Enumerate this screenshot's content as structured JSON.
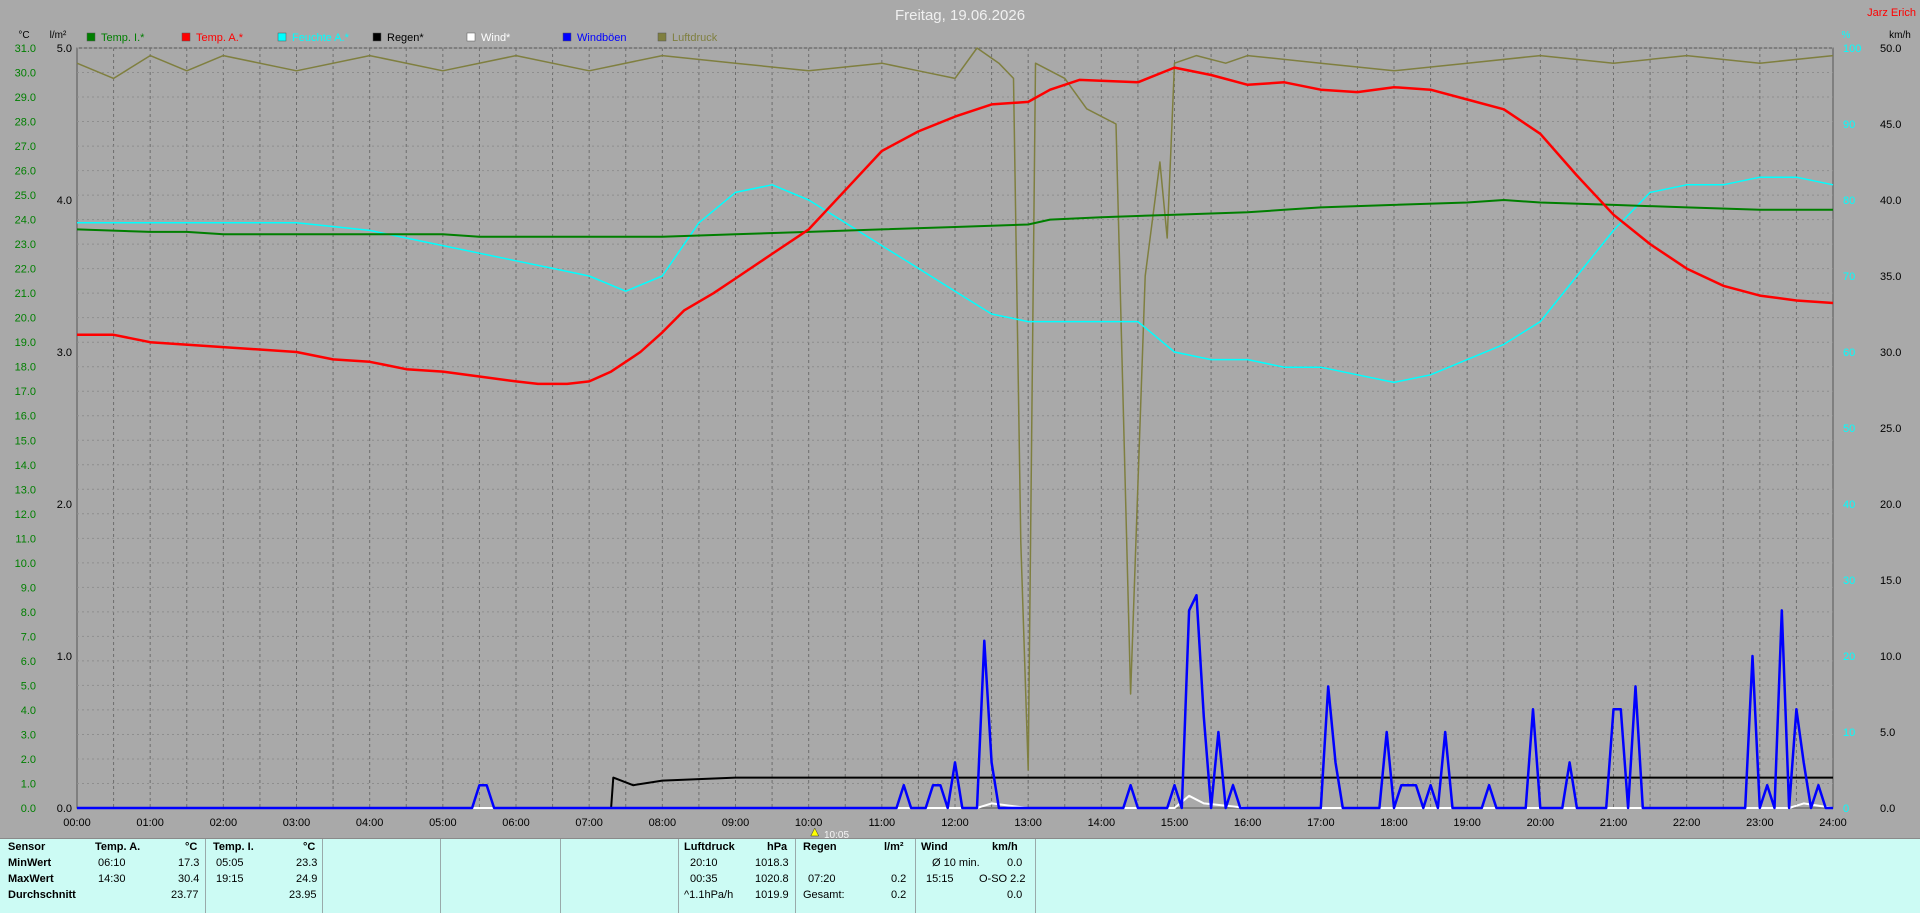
{
  "chart_data": {
    "type": "line",
    "title": "Freitag, 19.06.2026",
    "station": "Jarz Erich",
    "left_axis_unit": "°C",
    "left_axis2_unit": "l/m²",
    "right_axis_unit": "%",
    "right_axis2_unit": "km/h",
    "temp_ticks": [
      "0.0",
      "1.0",
      "2.0",
      "3.0",
      "4.0",
      "5.0",
      "6.0",
      "7.0",
      "8.0",
      "9.0",
      "10.0",
      "11.0",
      "12.0",
      "13.0",
      "14.0",
      "15.0",
      "16.0",
      "17.0",
      "18.0",
      "19.0",
      "20.0",
      "21.0",
      "22.0",
      "23.0",
      "24.0",
      "25.0",
      "26.0",
      "27.0",
      "28.0",
      "29.0",
      "30.0",
      "31.0"
    ],
    "rain_ticks": [
      "0.0",
      "1.0",
      "2.0",
      "3.0",
      "4.0",
      "5.0"
    ],
    "wind_ticks": [
      "0.0",
      "5.0",
      "10.0",
      "15.0",
      "20.0",
      "25.0",
      "30.0",
      "35.0",
      "40.0",
      "45.0",
      "50.0"
    ],
    "humidity_ticks": [
      "0",
      "10",
      "20",
      "30",
      "40",
      "50",
      "60",
      "70",
      "80",
      "90",
      "100"
    ],
    "x_labels": [
      "00:00",
      "01:00",
      "02:00",
      "03:00",
      "04:00",
      "05:00",
      "06:00",
      "07:00",
      "08:00",
      "09:00",
      "10:00",
      "11:00",
      "12:00",
      "13:00",
      "14:00",
      "15:00",
      "16:00",
      "17:00",
      "18:00",
      "19:00",
      "20:00",
      "21:00",
      "22:00",
      "23:00",
      "24:00"
    ],
    "xlim": [
      0,
      24
    ],
    "temp_ylim": [
      0,
      31
    ],
    "rain_ylim": [
      0,
      5
    ],
    "wind_ylim": [
      0,
      50
    ],
    "humidity_ylim": [
      0,
      100
    ],
    "marker_label": "10:05",
    "legend": [
      {
        "label": "Temp. I.*",
        "color": "#007f00"
      },
      {
        "label": "Temp. A.*",
        "color": "#ff0000"
      },
      {
        "label": "Feuchte A.*",
        "color": "#00ffff"
      },
      {
        "label": "Regen*",
        "color": "#000000"
      },
      {
        "label": "Wind*",
        "color": "#ffffff"
      },
      {
        "label": "Windböen",
        "color": "#0000ff"
      },
      {
        "label": "Luftdruck",
        "color": "#7f7f3f"
      }
    ],
    "series": [
      {
        "name": "Temp. I.*",
        "axis": "temp",
        "color": "#007f00",
        "points": [
          [
            0,
            23.6
          ],
          [
            1,
            23.5
          ],
          [
            1.5,
            23.5
          ],
          [
            2,
            23.4
          ],
          [
            3,
            23.4
          ],
          [
            4,
            23.4
          ],
          [
            5,
            23.4
          ],
          [
            5.5,
            23.3
          ],
          [
            6,
            23.3
          ],
          [
            7,
            23.3
          ],
          [
            8,
            23.3
          ],
          [
            9,
            23.4
          ],
          [
            10,
            23.5
          ],
          [
            11,
            23.6
          ],
          [
            12,
            23.7
          ],
          [
            13,
            23.8
          ],
          [
            13.3,
            24.0
          ],
          [
            14,
            24.1
          ],
          [
            15,
            24.2
          ],
          [
            16,
            24.3
          ],
          [
            16.5,
            24.4
          ],
          [
            17,
            24.5
          ],
          [
            18,
            24.6
          ],
          [
            19,
            24.7
          ],
          [
            19.5,
            24.8
          ],
          [
            20,
            24.7
          ],
          [
            21,
            24.6
          ],
          [
            22,
            24.5
          ],
          [
            23,
            24.4
          ],
          [
            24,
            24.4
          ]
        ]
      },
      {
        "name": "Temp. A.*",
        "axis": "temp",
        "color": "#ff0000",
        "points": [
          [
            0,
            19.3
          ],
          [
            0.5,
            19.3
          ],
          [
            1,
            19.0
          ],
          [
            2,
            18.8
          ],
          [
            3,
            18.6
          ],
          [
            3.5,
            18.3
          ],
          [
            4,
            18.2
          ],
          [
            4.5,
            17.9
          ],
          [
            5,
            17.8
          ],
          [
            5.5,
            17.6
          ],
          [
            6,
            17.4
          ],
          [
            6.3,
            17.3
          ],
          [
            6.7,
            17.3
          ],
          [
            7,
            17.4
          ],
          [
            7.3,
            17.8
          ],
          [
            7.7,
            18.6
          ],
          [
            8,
            19.4
          ],
          [
            8.3,
            20.3
          ],
          [
            8.7,
            21.0
          ],
          [
            9,
            21.6
          ],
          [
            9.5,
            22.6
          ],
          [
            10,
            23.6
          ],
          [
            10.5,
            25.2
          ],
          [
            11,
            26.8
          ],
          [
            11.5,
            27.6
          ],
          [
            12,
            28.2
          ],
          [
            12.5,
            28.7
          ],
          [
            13,
            28.8
          ],
          [
            13.3,
            29.3
          ],
          [
            13.7,
            29.7
          ],
          [
            14.5,
            29.6
          ],
          [
            15,
            30.2
          ],
          [
            15.5,
            29.9
          ],
          [
            16,
            29.5
          ],
          [
            16.5,
            29.6
          ],
          [
            17,
            29.3
          ],
          [
            17.5,
            29.2
          ],
          [
            18,
            29.4
          ],
          [
            18.5,
            29.3
          ],
          [
            19,
            28.9
          ],
          [
            19.5,
            28.5
          ],
          [
            20,
            27.5
          ],
          [
            20.5,
            25.8
          ],
          [
            21,
            24.2
          ],
          [
            21.5,
            23.0
          ],
          [
            22,
            22.0
          ],
          [
            22.5,
            21.3
          ],
          [
            23,
            20.9
          ],
          [
            23.5,
            20.7
          ],
          [
            24,
            20.6
          ]
        ]
      },
      {
        "name": "Feuchte A.*",
        "axis": "humidity",
        "color": "#00ffff",
        "points": [
          [
            0,
            77
          ],
          [
            1,
            77
          ],
          [
            2,
            77
          ],
          [
            3,
            77
          ],
          [
            4,
            76
          ],
          [
            5,
            74
          ],
          [
            5.5,
            73
          ],
          [
            6,
            72
          ],
          [
            6.5,
            71
          ],
          [
            7,
            70
          ],
          [
            7.5,
            68
          ],
          [
            8,
            70
          ],
          [
            8.5,
            77
          ],
          [
            9,
            81
          ],
          [
            9.5,
            82
          ],
          [
            10,
            80
          ],
          [
            10.5,
            77
          ],
          [
            11,
            74
          ],
          [
            11.5,
            71
          ],
          [
            12,
            68
          ],
          [
            12.5,
            65
          ],
          [
            13,
            64
          ],
          [
            13.5,
            64
          ],
          [
            14,
            64
          ],
          [
            14.5,
            64
          ],
          [
            15,
            60
          ],
          [
            15.5,
            59
          ],
          [
            16,
            59
          ],
          [
            16.5,
            58
          ],
          [
            17,
            58
          ],
          [
            17.5,
            57
          ],
          [
            18,
            56
          ],
          [
            18.5,
            57
          ],
          [
            19,
            59
          ],
          [
            19.5,
            61
          ],
          [
            20,
            64
          ],
          [
            20.5,
            70
          ],
          [
            21,
            76
          ],
          [
            21.5,
            81
          ],
          [
            22,
            82
          ],
          [
            22.5,
            82
          ],
          [
            23,
            83
          ],
          [
            23.5,
            83
          ],
          [
            24,
            82
          ]
        ]
      },
      {
        "name": "Regen*",
        "axis": "rain",
        "color": "#000000",
        "points": [
          [
            0,
            0
          ],
          [
            7.3,
            0
          ],
          [
            7.33,
            0.2
          ],
          [
            7.6,
            0.15
          ],
          [
            8,
            0.18
          ],
          [
            9,
            0.2
          ],
          [
            12,
            0.2
          ],
          [
            16,
            0.2
          ],
          [
            20,
            0.2
          ],
          [
            24,
            0.2
          ]
        ]
      },
      {
        "name": "Wind*",
        "axis": "wind",
        "color": "#ffffff",
        "points": [
          [
            0,
            0
          ],
          [
            12.3,
            0
          ],
          [
            12.5,
            0.3
          ],
          [
            13,
            0
          ],
          [
            15,
            0
          ],
          [
            15.2,
            0.8
          ],
          [
            15.4,
            0.3
          ],
          [
            16,
            0
          ],
          [
            23.4,
            0
          ],
          [
            23.6,
            0.3
          ],
          [
            24,
            0
          ]
        ]
      },
      {
        "name": "Windböen",
        "axis": "wind",
        "color": "#0000ff",
        "points": [
          [
            0,
            0
          ],
          [
            5.4,
            0
          ],
          [
            5.5,
            1.5
          ],
          [
            5.6,
            1.5
          ],
          [
            5.7,
            0
          ],
          [
            11.2,
            0
          ],
          [
            11.3,
            1.5
          ],
          [
            11.4,
            0
          ],
          [
            11.6,
            0
          ],
          [
            11.7,
            1.5
          ],
          [
            11.8,
            1.5
          ],
          [
            11.9,
            0
          ],
          [
            12.0,
            3.0
          ],
          [
            12.1,
            0
          ],
          [
            12.3,
            0
          ],
          [
            12.4,
            11.0
          ],
          [
            12.5,
            3.0
          ],
          [
            12.6,
            0
          ],
          [
            14.3,
            0
          ],
          [
            14.4,
            1.5
          ],
          [
            14.5,
            0
          ],
          [
            14.9,
            0
          ],
          [
            15.0,
            1.5
          ],
          [
            15.1,
            0
          ],
          [
            15.2,
            13.0
          ],
          [
            15.3,
            14.0
          ],
          [
            15.4,
            6.0
          ],
          [
            15.5,
            0
          ],
          [
            15.6,
            5.0
          ],
          [
            15.7,
            0
          ],
          [
            15.8,
            1.5
          ],
          [
            15.9,
            0
          ],
          [
            17.0,
            0
          ],
          [
            17.1,
            8.0
          ],
          [
            17.2,
            3.0
          ],
          [
            17.3,
            0
          ],
          [
            17.8,
            0
          ],
          [
            17.9,
            5.0
          ],
          [
            18.0,
            0
          ],
          [
            18.1,
            1.5
          ],
          [
            18.3,
            1.5
          ],
          [
            18.4,
            0
          ],
          [
            18.5,
            1.5
          ],
          [
            18.6,
            0
          ],
          [
            18.7,
            5.0
          ],
          [
            18.8,
            0
          ],
          [
            19.2,
            0
          ],
          [
            19.3,
            1.5
          ],
          [
            19.4,
            0
          ],
          [
            19.8,
            0
          ],
          [
            19.9,
            6.5
          ],
          [
            20.0,
            0
          ],
          [
            20.3,
            0
          ],
          [
            20.4,
            3.0
          ],
          [
            20.5,
            0
          ],
          [
            20.9,
            0
          ],
          [
            21.0,
            6.5
          ],
          [
            21.1,
            6.5
          ],
          [
            21.2,
            0
          ],
          [
            21.3,
            8.0
          ],
          [
            21.4,
            0
          ],
          [
            22.8,
            0
          ],
          [
            22.9,
            10.0
          ],
          [
            23.0,
            0
          ],
          [
            23.1,
            1.5
          ],
          [
            23.2,
            0
          ],
          [
            23.3,
            13.0
          ],
          [
            23.4,
            0
          ],
          [
            23.5,
            6.5
          ],
          [
            23.6,
            3.0
          ],
          [
            23.7,
            0
          ],
          [
            23.8,
            1.5
          ],
          [
            23.9,
            0
          ],
          [
            24,
            0
          ]
        ]
      },
      {
        "name": "Luftdruck",
        "axis": "pressure_curve",
        "color": "#7f7f3f",
        "points": [
          [
            0,
            98
          ],
          [
            0.5,
            96
          ],
          [
            1,
            99
          ],
          [
            1.5,
            97
          ],
          [
            2,
            99
          ],
          [
            3,
            97
          ],
          [
            4,
            99
          ],
          [
            5,
            97
          ],
          [
            6,
            99
          ],
          [
            7,
            97
          ],
          [
            8,
            99
          ],
          [
            9,
            98
          ],
          [
            10,
            97
          ],
          [
            11,
            98
          ],
          [
            11.5,
            97
          ],
          [
            12,
            96
          ],
          [
            12.3,
            100
          ],
          [
            12.6,
            98
          ],
          [
            12.8,
            96
          ],
          [
            12.9,
            35
          ],
          [
            13.0,
            5
          ],
          [
            13.1,
            98
          ],
          [
            13.5,
            96
          ],
          [
            13.8,
            92
          ],
          [
            14.2,
            90
          ],
          [
            14.4,
            15
          ],
          [
            14.6,
            70
          ],
          [
            14.8,
            85
          ],
          [
            14.9,
            75
          ],
          [
            15.0,
            98
          ],
          [
            15.3,
            99
          ],
          [
            15.7,
            98
          ],
          [
            16,
            99
          ],
          [
            17,
            98
          ],
          [
            18,
            97
          ],
          [
            19,
            98
          ],
          [
            20,
            99
          ],
          [
            21,
            98
          ],
          [
            22,
            99
          ],
          [
            23,
            98
          ],
          [
            24,
            99
          ]
        ]
      }
    ]
  },
  "summary": {
    "row_labels": {
      "sensor": "Sensor",
      "min": "MinWert",
      "max": "MaxWert",
      "avg": "Durchschnitt"
    },
    "temp_a": {
      "header": "Temp. A.",
      "unit": "°C",
      "min_time": "06:10",
      "min_val": "17.3",
      "max_time": "14:30",
      "max_val": "30.4",
      "avg_val": "23.77"
    },
    "temp_i": {
      "header": "Temp. I.",
      "unit": "°C",
      "min_time": "05:05",
      "min_val": "23.3",
      "max_time": "19:15",
      "max_val": "24.9",
      "avg_val": "23.95"
    },
    "pressure": {
      "header": "Luftdruck",
      "unit": "hPa",
      "min_time": "20:10",
      "min_val": "1018.3",
      "max_time": "00:35",
      "max_val": "1020.8",
      "trend_label": "^1.1hPa/h",
      "trend_val": "1019.9"
    },
    "rain": {
      "header": "Regen",
      "unit": "l/m²",
      "max_time": "07:20",
      "max_val": "0.2",
      "total_label": "Gesamt:",
      "total_val": "0.2"
    },
    "wind": {
      "header": "Wind",
      "unit": "km/h",
      "avg_label": "Ø 10 min.",
      "avg_val": "0.0",
      "max_time": "15:15",
      "max_dir_val": "O-SO 2.2",
      "avg2_val": "0.0"
    }
  }
}
